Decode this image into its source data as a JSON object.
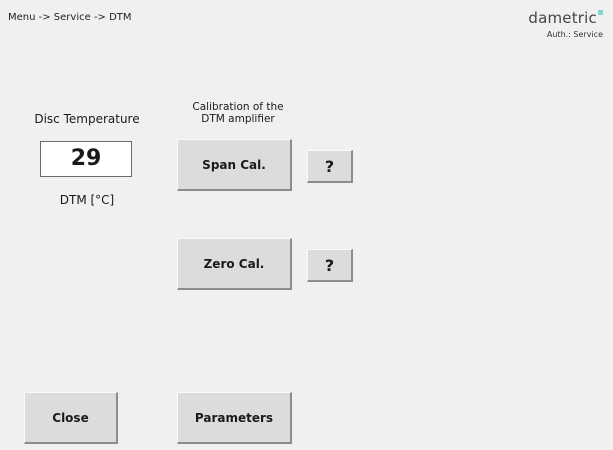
{
  "header": {
    "breadcrumb": "Menu -> Service -> DTM",
    "brand": "dametric",
    "auth": "Auth.: Service"
  },
  "disc_temperature": {
    "label": "Disc Temperature",
    "value": "29",
    "unit": "DTM [°C]"
  },
  "calibration": {
    "label": "Calibration of the\nDTM amplifier",
    "span_label": "Span Cal.",
    "zero_label": "Zero Cal.",
    "help_label": "?"
  },
  "footer": {
    "close_label": "Close",
    "parameters_label": "Parameters"
  },
  "colors": {
    "background": "#f0f0f0",
    "button": "#dcdcdc",
    "brand_accent": "#7fd6c7"
  }
}
